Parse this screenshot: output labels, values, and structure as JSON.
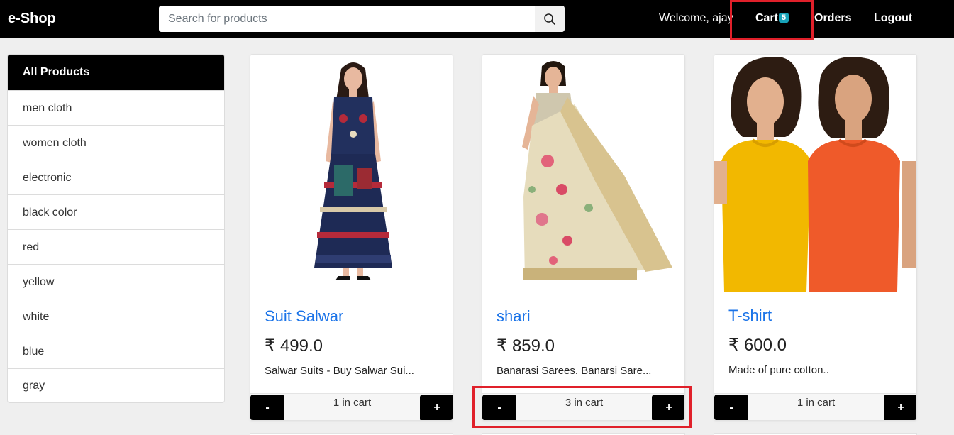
{
  "nav": {
    "brand": "e-Shop",
    "search_placeholder": "Search for products",
    "search_icon": "search-icon",
    "welcome": "Welcome, ajay",
    "cart_label": "Cart",
    "cart_count": "5",
    "orders_label": "Orders",
    "logout_label": "Logout"
  },
  "sidebar": {
    "items": [
      {
        "label": "All Products"
      },
      {
        "label": "men cloth"
      },
      {
        "label": "women cloth"
      },
      {
        "label": "electronic"
      },
      {
        "label": "black color"
      },
      {
        "label": "red"
      },
      {
        "label": "yellow"
      },
      {
        "label": "white"
      },
      {
        "label": "blue"
      },
      {
        "label": "gray"
      }
    ]
  },
  "products": [
    {
      "title": "Suit Salwar",
      "price": "₹ 499.0",
      "desc": "Salwar Suits - Buy Salwar Sui...",
      "cart": "1 in cart",
      "minus": "-",
      "plus": "+"
    },
    {
      "title": "shari",
      "price": "₹ 859.0",
      "desc": "Banarasi Sarees. Banarsi Sare...",
      "cart": "3 in cart",
      "minus": "-",
      "plus": "+"
    },
    {
      "title": "T-shirt",
      "price": "₹ 600.0",
      "desc": "Made of pure cotton..",
      "cart": "1 in cart",
      "minus": "-",
      "plus": "+"
    }
  ],
  "colors": {
    "navbar": "#000000",
    "link": "#1a73e8",
    "badge": "#17a2b8",
    "highlight": "#e0202a"
  }
}
